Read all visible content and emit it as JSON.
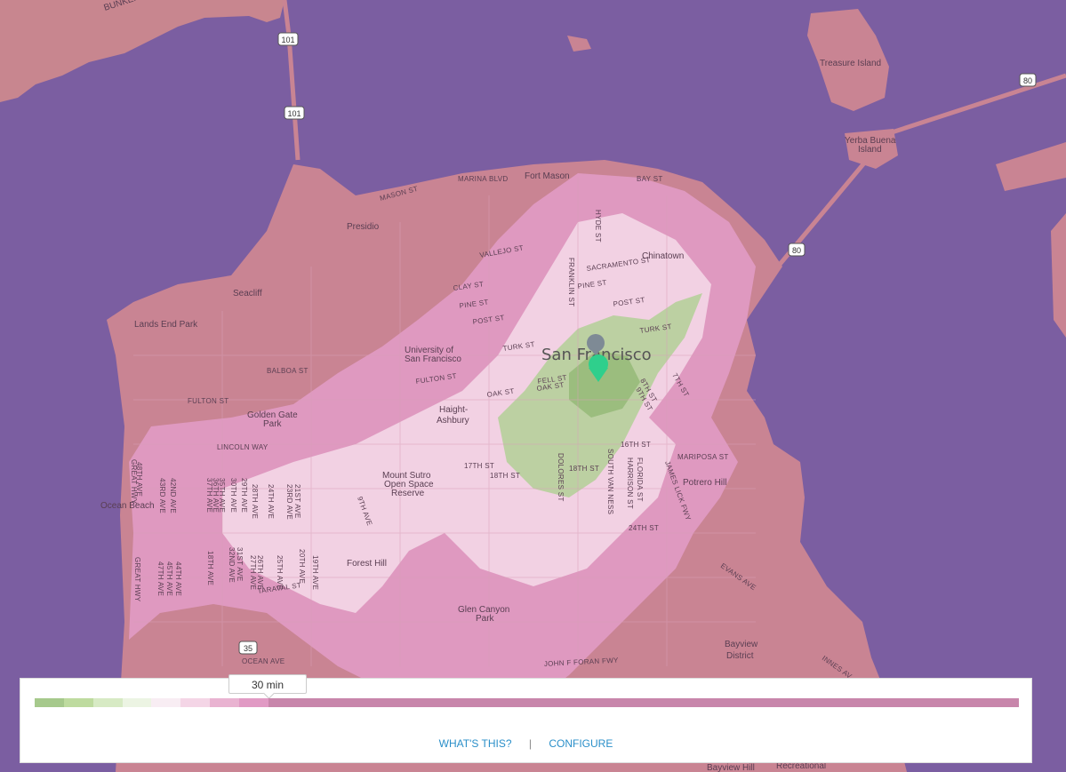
{
  "map": {
    "city": "San Francisco",
    "pins": [
      {
        "name": "origin-pin",
        "color": "#7e8a95"
      },
      {
        "name": "destination-pin",
        "color": "#2fcf8c"
      }
    ],
    "places": {
      "bunker_rd": "BUNKER R",
      "fort_mason": "Fort Mason",
      "treasure_island": "Treasure Island",
      "yerba_buena": "Yerba Buena",
      "yerba_buena_2": "Island",
      "presidio": "Presidio",
      "seacliff": "Seacliff",
      "lands_end": "Lands End Park",
      "chinatown": "Chinatown",
      "usf_1": "University of",
      "usf_2": "San Francisco",
      "golden_gate_1": "Golden Gate",
      "golden_gate_2": "Park",
      "haight_1": "Haight-",
      "haight_2": "Ashbury",
      "ocean_beach": "Ocean Beach",
      "sutro_1": "Mount Sutro",
      "sutro_2": "Open Space",
      "sutro_3": "Reserve",
      "forest_hill": "Forest Hill",
      "glen_canyon_1": "Glen Canyon",
      "glen_canyon_2": "Park",
      "potrero": "Potrero Hill",
      "bayview_1": "Bayview",
      "bayview_2": "District",
      "bayview_hill": "Bayview Hill",
      "recreational": "Recreational"
    },
    "streets": {
      "marina": "MARINA BLVD",
      "bay": "BAY ST",
      "mason": "MASON ST",
      "vallejo": "VALLEJO ST",
      "sacramento": "SACRAMENTO ST",
      "pine": "PINE ST",
      "post": "POST ST",
      "clay": "CLAY ST",
      "pine2": "PINE ST",
      "post2": "POST ST",
      "turk": "TURK ST",
      "turk2": "TURK ST",
      "balboa": "BALBOA ST",
      "fulton": "FULTON ST",
      "fulton2": "FULTON ST",
      "fell": "FELL ST",
      "oak": "OAK ST",
      "oak2": "OAK ST",
      "lincoln": "LINCOLN WAY",
      "s17": "17TH ST",
      "s18": "18TH ST",
      "s18b": "18TH ST",
      "s16": "16TH ST",
      "s24": "24TH ST",
      "mariposa": "MARIPOSA ST",
      "s7": "7TH ST",
      "s8": "8TH ST",
      "s9": "9TH ST",
      "evans": "EVANS AVE",
      "innes": "INNES AV",
      "taraval": "TARAVAL ST",
      "ocean": "OCEAN AVE",
      "foran": "JOHN F FORAN FWY",
      "great_hwy": "GREAT HWY",
      "great_hwy2": "GREAT HWY",
      "hyde": "HYDE ST",
      "franklin": "FRANKLIN ST",
      "dolores": "DOLORES ST",
      "florida": "FLORIDA ST",
      "harrison": "HARRISON ST",
      "s48": "48TH AVE",
      "s43": "43RD AVE",
      "s42": "42ND AVE",
      "s19": "19TH AVE",
      "s9ave": "9TH AVE",
      "s30": "30TH AVE",
      "s29": "29TH AVE",
      "s35": "35TH AVE",
      "s36": "36TH AVE",
      "s37": "37TH AVE",
      "s28": "28TH AVE",
      "s23": "23RD AVE",
      "s24ave": "24TH AVE",
      "s21": "21ST AVE",
      "s20": "20TH AVE",
      "s31": "31ST AVE",
      "s32": "32ND AVE",
      "s25": "25TH AVE",
      "s26": "26TH AVE",
      "s44": "44TH AVE",
      "s45": "45TH AVE",
      "s47": "47TH AVE",
      "s27": "27TH AVE",
      "s18ave": "18TH AVE",
      "south_van_ness": "SOUTH VAN NESS",
      "james_lick": "JAMES LICK FWY"
    },
    "shields": {
      "h101a": "101",
      "h101b": "101",
      "h80a": "80",
      "h80b": "80",
      "h35": "35"
    },
    "colors": {
      "water": "#7b5ea1",
      "land": "#c98493",
      "heat_far": "#e39cc8",
      "heat_mid": "#f6dbe9",
      "heat_near": "#a9cf8c"
    }
  },
  "legend": {
    "tooltip": "30 min",
    "links": {
      "whats_this": "WHAT'S THIS?",
      "separator": "|",
      "configure": "CONFIGURE"
    },
    "scale": [
      {
        "color": "#a6c98c",
        "value": 1
      },
      {
        "color": "#bedb9f",
        "value": 1
      },
      {
        "color": "#d7eac4",
        "value": 1
      },
      {
        "color": "#ecf4e3",
        "value": 1
      },
      {
        "color": "#f8edf3",
        "value": 1
      },
      {
        "color": "#f4d5e6",
        "value": 1
      },
      {
        "color": "#e9b3d1",
        "value": 1
      },
      {
        "color": "#e19ac4",
        "value": 1
      },
      {
        "color": "#c886ab",
        "value": 25.7
      }
    ]
  }
}
